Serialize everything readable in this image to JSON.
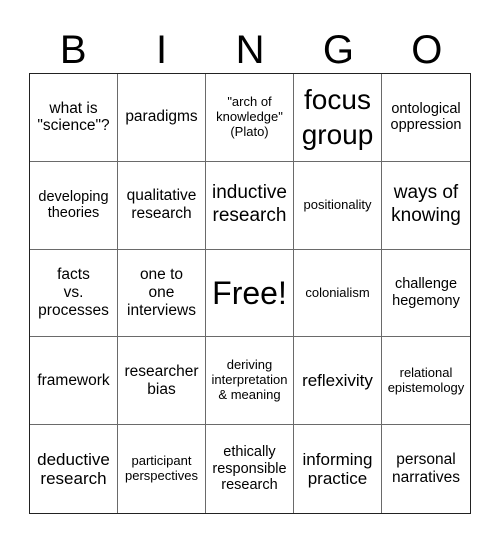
{
  "card": {
    "header": [
      "B",
      "I",
      "N",
      "G",
      "O"
    ],
    "rows": [
      [
        {
          "text": "what is\n\"science\"?",
          "size": "fs-15"
        },
        {
          "text": "paradigms",
          "size": "fs-15"
        },
        {
          "text": "\"arch of\nknowledge\"\n(Plato)",
          "size": "fs-13"
        },
        {
          "text": "focus\ngroup",
          "size": "fs-28"
        },
        {
          "text": "ontological\noppression",
          "size": "fs-14"
        }
      ],
      [
        {
          "text": "developing\ntheories",
          "size": "fs-14"
        },
        {
          "text": "qualitative\nresearch",
          "size": "fs-15"
        },
        {
          "text": "inductive\nresearch",
          "size": "fs-19"
        },
        {
          "text": "positionality",
          "size": "fs-13"
        },
        {
          "text": "ways of\nknowing",
          "size": "fs-19"
        }
      ],
      [
        {
          "text": "facts\nvs.\nprocesses",
          "size": "fs-15"
        },
        {
          "text": "one to\none\ninterviews",
          "size": "fs-15"
        },
        {
          "text": "Free!",
          "size": "fs-free"
        },
        {
          "text": "colonialism",
          "size": "fs-13"
        },
        {
          "text": "challenge\nhegemony",
          "size": "fs-14"
        }
      ],
      [
        {
          "text": "framework",
          "size": "fs-15"
        },
        {
          "text": "researcher\nbias",
          "size": "fs-15"
        },
        {
          "text": "deriving\ninterpretation\n& meaning",
          "size": "fs-13"
        },
        {
          "text": "reflexivity",
          "size": "fs-17"
        },
        {
          "text": "relational\nepistemology",
          "size": "fs-13"
        }
      ],
      [
        {
          "text": "deductive\nresearch",
          "size": "fs-17"
        },
        {
          "text": "participant\nperspectives",
          "size": "fs-13"
        },
        {
          "text": "ethically\nresponsible\nresearch",
          "size": "fs-14"
        },
        {
          "text": "informing\npractice",
          "size": "fs-17"
        },
        {
          "text": "personal\nnarratives",
          "size": "fs-15"
        }
      ]
    ]
  }
}
